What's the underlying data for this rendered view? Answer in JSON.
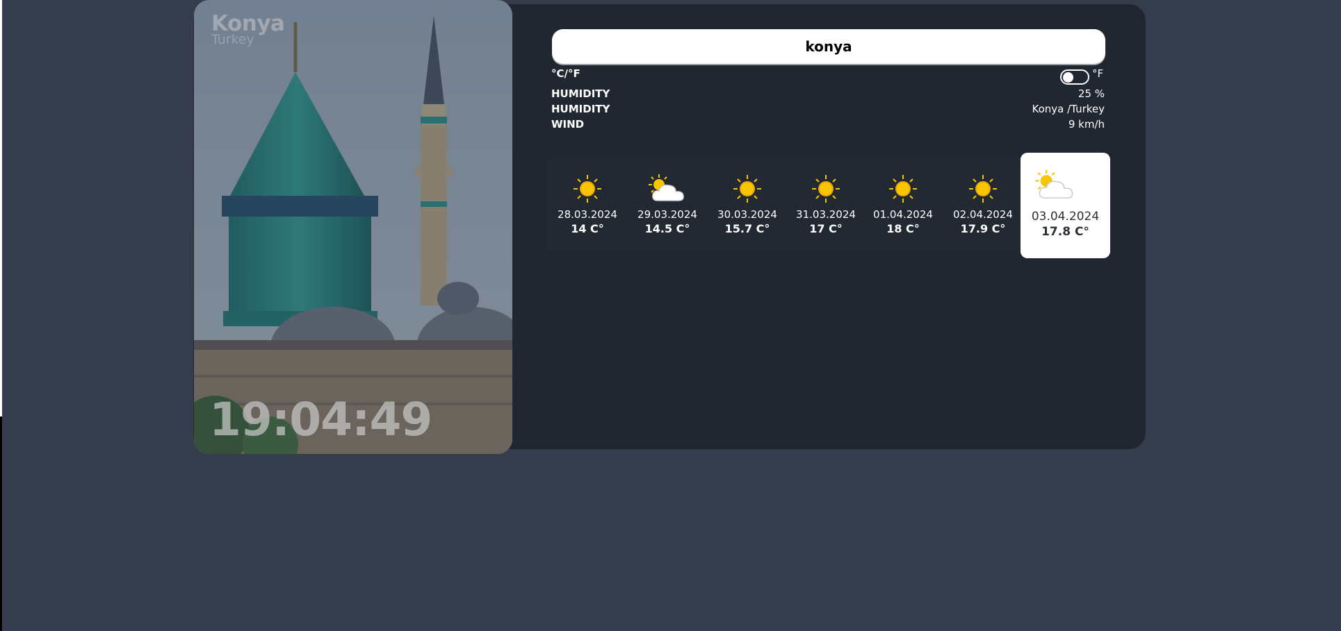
{
  "location": {
    "city": "Konya",
    "country": "Turkey"
  },
  "clock": "19:04:49",
  "search": {
    "value": "konya"
  },
  "units": {
    "label": "°C/°F",
    "toggle_label": "°F"
  },
  "details": [
    {
      "label": "HUMIDITY",
      "value": "25 %"
    },
    {
      "label": "HUMIDITY",
      "value": "Konya /Turkey"
    },
    {
      "label": "WIND",
      "value": "9 km/h"
    }
  ],
  "forecast": [
    {
      "date": "28.03.2024",
      "temp": "14 C°",
      "icon": "sun-icon"
    },
    {
      "date": "29.03.2024",
      "temp": "14.5 C°",
      "icon": "partly-cloudy-icon"
    },
    {
      "date": "30.03.2024",
      "temp": "15.7 C°",
      "icon": "sun-icon"
    },
    {
      "date": "31.03.2024",
      "temp": "17 C°",
      "icon": "sun-icon"
    },
    {
      "date": "01.04.2024",
      "temp": "18 C°",
      "icon": "sun-icon"
    },
    {
      "date": "02.04.2024",
      "temp": "17.9 C°",
      "icon": "sun-icon"
    },
    {
      "date": "03.04.2024",
      "temp": "17.8 C°",
      "icon": "partly-cloudy-icon",
      "selected": true
    }
  ],
  "colors": {
    "background": "#353d4c",
    "card": "#212731",
    "sun": "#f7c600"
  }
}
